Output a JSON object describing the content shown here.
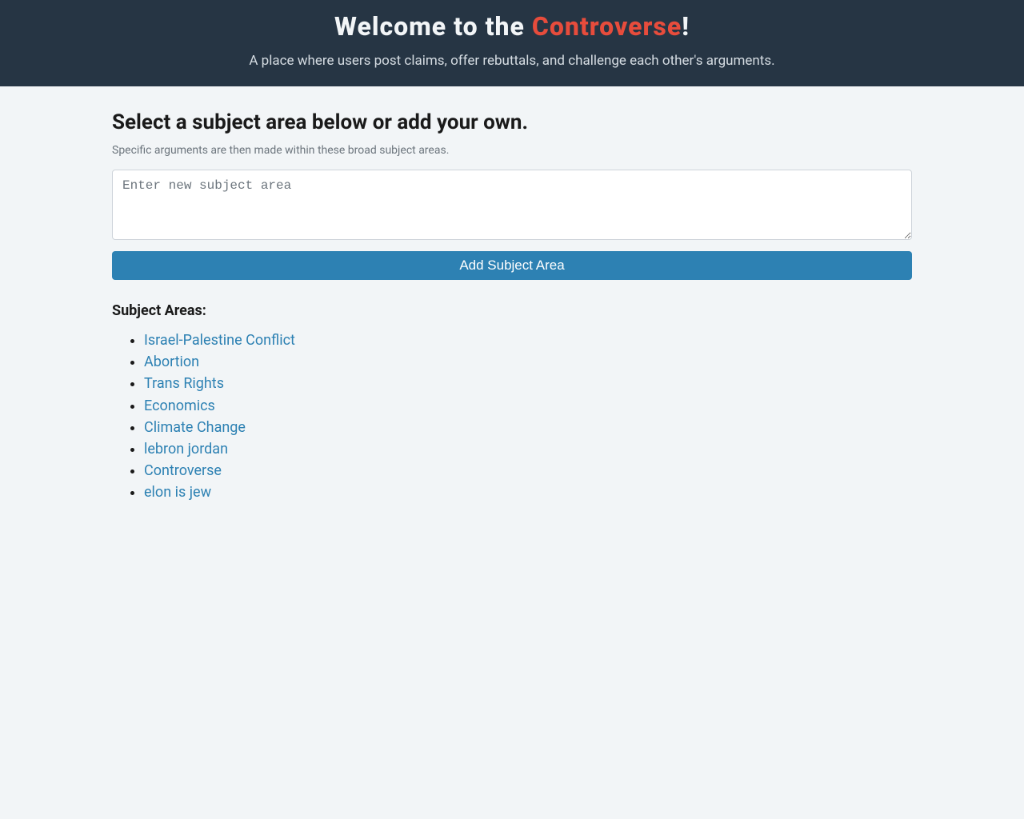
{
  "header": {
    "title_prefix": "Welcome to the ",
    "title_brand": "Controverse",
    "title_suffix": "!",
    "subtitle": "A place where users post claims, offer rebuttals, and challenge each other's arguments."
  },
  "main": {
    "heading": "Select a subject area below or add your own.",
    "subheading": "Specific arguments are then made within these broad subject areas.",
    "textarea_placeholder": "Enter new subject area",
    "add_button_label": "Add Subject Area",
    "list_heading": "Subject Areas:",
    "subject_areas": [
      "Israel-Palestine Conflict",
      "Abortion",
      "Trans Rights",
      "Economics",
      "Climate Change",
      "lebron jordan",
      "Controverse",
      "elon is jew"
    ]
  }
}
